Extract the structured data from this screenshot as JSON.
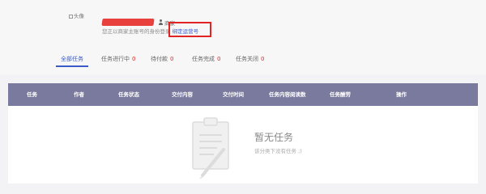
{
  "profile": {
    "avatar_alt": "头像",
    "role": "商家",
    "notice_text": "您正以商家主账号的身份登录",
    "bind_link": "绑定运营号"
  },
  "tabs": [
    {
      "label": "全部任务",
      "count": ""
    },
    {
      "label": "任务进行中",
      "count": "0"
    },
    {
      "label": "待付款",
      "count": "0"
    },
    {
      "label": "任务完成",
      "count": "0"
    },
    {
      "label": "任务关闭",
      "count": "0"
    }
  ],
  "table": {
    "columns": [
      "任务",
      "作者",
      "任务状态",
      "交付内容",
      "交付时间",
      "任务内容阅读数",
      "任务酬劳",
      "操作"
    ]
  },
  "empty": {
    "title": "暂无任务",
    "subtitle": "该分类下没有任务 ;)"
  },
  "colors": {
    "accent": "#3a5bc7",
    "count_red": "#e02424",
    "table_header": "#7a7a9e"
  }
}
